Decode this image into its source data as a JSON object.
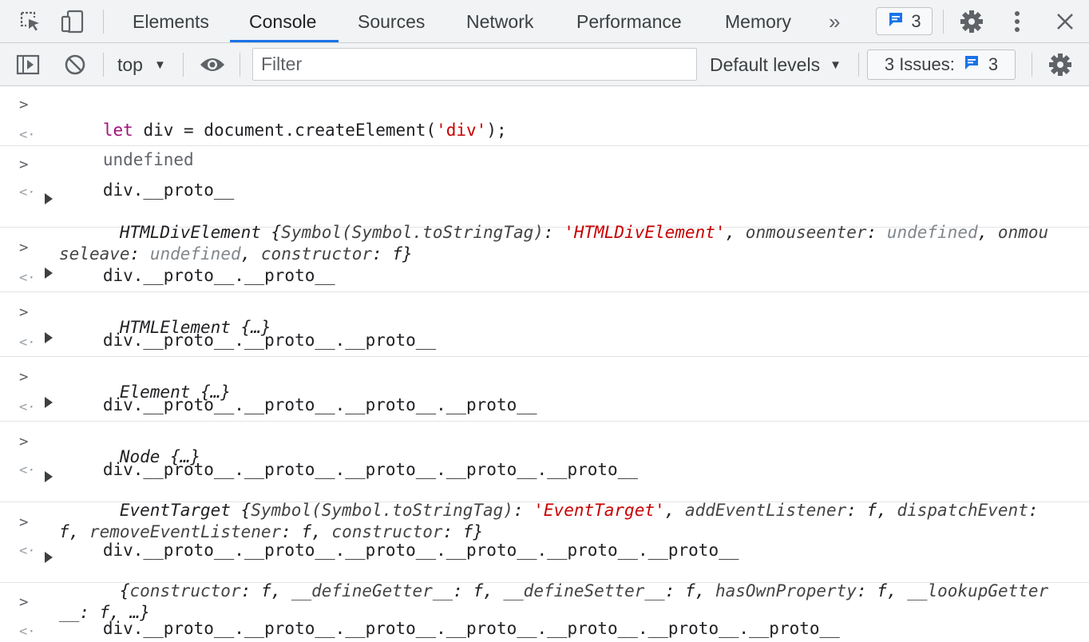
{
  "tabbar": {
    "tabs": [
      "Elements",
      "Console",
      "Sources",
      "Network",
      "Performance",
      "Memory"
    ],
    "active_tab": "Console",
    "more_tabs": "»",
    "issues_count": "3"
  },
  "toolbar": {
    "context": "top",
    "filter_placeholder": "Filter",
    "levels": "Default levels",
    "issues_label": "3 Issues:",
    "issues_count": "3"
  },
  "colors": {
    "accent": "#1a73e8",
    "keyword": "#a1137b",
    "string": "#c80000",
    "muted": "#80868b"
  },
  "console": {
    "e1_input_kw": "let",
    "e1_input_rest": " div = document.createElement(",
    "e1_input_str": "'div'",
    "e1_input_end": ");",
    "e1_result": "undefined",
    "e2_input": "div.__proto__",
    "e2_name": "HTMLDivElement",
    "e2_k1": "Symbol(Symbol.toStringTag)",
    "e2_v1": "'HTMLDivElement'",
    "e2_k2": "onmouseenter",
    "e2_v2": "undefined",
    "e2_k3a": "onmous",
    "e2_k3b": "eleave",
    "e2_v3": "undefined",
    "e2_k4": "constructor",
    "e2_v4": "f",
    "e3_input": "div.__proto__.__proto__",
    "e3_result": "HTMLElement {…}",
    "e4_input": "div.__proto__.__proto__.__proto__",
    "e4_result": "Element {…}",
    "e5_input": "div.__proto__.__proto__.__proto__.__proto__",
    "e5_result": "Node {…}",
    "e6_input": "div.__proto__.__proto__.__proto__.__proto__.__proto__",
    "e6_name": "EventTarget",
    "e6_k1": "Symbol(Symbol.toStringTag)",
    "e6_v1": "'EventTarget'",
    "e6_k2": "addEventListener",
    "e6_k3": "dispatchEvent",
    "e6_k4": "removeEventListener",
    "e6_k5": "constructor",
    "e6_f": "f",
    "e7_input": "div.__proto__.__proto__.__proto__.__proto__.__proto__.__proto__",
    "e7_k1": "constructor",
    "e7_k2": "__defineGetter__",
    "e7_k3": "__defineSetter__",
    "e7_k4": "hasOwnProperty",
    "e7_k5a": "__lookupGetter_",
    "e7_k5b": "_",
    "e7_f": "f",
    "e7_ellipsis": "…",
    "e8_input": "div.__proto__.__proto__.__proto__.__proto__.__proto__.__proto__.__proto__",
    "e8_result": "null"
  }
}
